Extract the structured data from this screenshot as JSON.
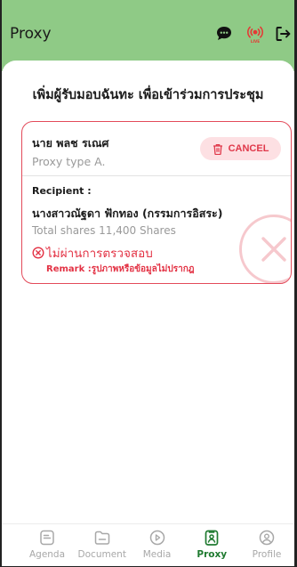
{
  "header": {
    "title": "Proxy",
    "live_badge": "LIVE"
  },
  "page": {
    "title": "เพิ่มผู้รับมอบฉันทะ เพื่อเข้าร่วมการประชุม"
  },
  "proxy_card": {
    "proxy_name": "นาย พลช รเณศ",
    "proxy_type": "Proxy type A.",
    "cancel_label": "CANCEL",
    "recipient_label": "Recipient :",
    "recipient_name": "นางสาวณัฐดา ฟักทอง (กรรมการอิสระ)",
    "total_shares": "Total shares 11,400 Shares",
    "status_text": "ไม่ผ่านการตรวจสอบ",
    "remark": "Remark :รูปภาพหรือข้อมูลไม่ปรากฎ"
  },
  "bottom_nav": {
    "items": [
      {
        "label": "Agenda",
        "icon": "agenda-icon",
        "active": false
      },
      {
        "label": "Document",
        "icon": "folder-icon",
        "active": false
      },
      {
        "label": "Media",
        "icon": "play-icon",
        "active": false
      },
      {
        "label": "Proxy",
        "icon": "proxy-icon",
        "active": true
      },
      {
        "label": "Profile",
        "icon": "profile-icon",
        "active": false
      }
    ]
  },
  "colors": {
    "header_bg": "#8fca86",
    "accent_red": "#e33244",
    "active_green": "#1f7a30"
  }
}
